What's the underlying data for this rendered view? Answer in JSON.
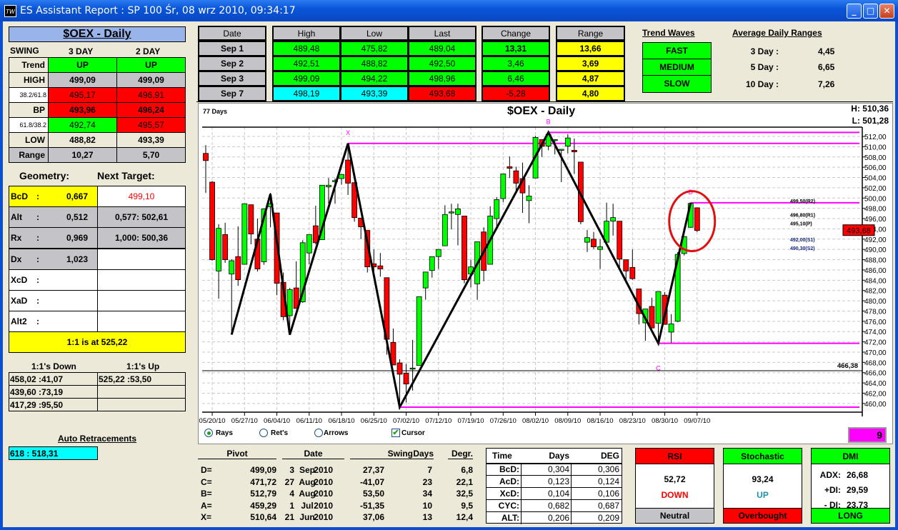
{
  "window": {
    "title": "ES Assistant Report : SP 100  Śr, 08 wrz 2010, 09:34:17",
    "app_icon": "TW",
    "minimize": "_",
    "maximize": "□",
    "close": "✕"
  },
  "swing": {
    "title": "$OEX - Daily",
    "col0": "SWING",
    "col1": "3 DAY",
    "col2": "2 DAY",
    "rows": [
      {
        "label": "Trend",
        "v3": "UP",
        "v2": "UP"
      },
      {
        "label": "HIGH",
        "v3": "499,09",
        "v2": "499,09"
      },
      {
        "label": "38.2/61.8",
        "v3": "495,17",
        "v2": "496,91"
      },
      {
        "label": "BP",
        "v3": "493,96",
        "v2": "496,24"
      },
      {
        "label": "61.8/38.2",
        "v3": "492,74",
        "v2": "495,57"
      },
      {
        "label": "LOW",
        "v3": "488,82",
        "v2": "493,39"
      },
      {
        "label": "Range",
        "v3": "10,27",
        "v2": "5,70"
      }
    ]
  },
  "geometry": {
    "title": "Geometry:",
    "next_title": "Next Target:",
    "rows": [
      {
        "label": "BcD",
        "sep": ":",
        "value": "0,667",
        "target": "499,10"
      },
      {
        "label": "Alt",
        "sep": ":",
        "value": "0,512",
        "target": "0,577: 502,61"
      },
      {
        "label": "Rx",
        "sep": ":",
        "value": "0,969",
        "target": "1,000: 500,36"
      },
      {
        "label": "Dx",
        "sep": ":",
        "value": "1,023",
        "target": ""
      },
      {
        "label": "XcD",
        "sep": ":",
        "value": "",
        "target": ""
      },
      {
        "label": "XaD",
        "sep": ":",
        "value": "",
        "target": ""
      },
      {
        "label": "Alt2",
        "sep": ":",
        "value": "",
        "target": ""
      }
    ],
    "one_to_one": "1:1 is at 525,22"
  },
  "ones": {
    "down_title": "1:1's Down",
    "up_title": "1:1's Up",
    "down": [
      "458,02 :41,07",
      "439,60 :73,19",
      "417,29 :95,50"
    ],
    "up": [
      "525,22 :53,50",
      "",
      ""
    ]
  },
  "auto_retracements": {
    "title": "Auto Retracements",
    "value": "618 : 518,31"
  },
  "daily": {
    "headers": {
      "date": "Date",
      "high": "High",
      "low": "Low",
      "last": "Last",
      "change": "Change",
      "range": "Range"
    },
    "rows": [
      {
        "date": "Sep  1",
        "high": "489,48",
        "low": "475,82",
        "last": "489,04",
        "change": "13,31",
        "range": "13,66"
      },
      {
        "date": "Sep  2",
        "high": "492,51",
        "low": "488,82",
        "last": "492,50",
        "change": "3,46",
        "range": "3,69"
      },
      {
        "date": "Sep  3",
        "high": "499,09",
        "low": "494,22",
        "last": "498,96",
        "change": "6,46",
        "range": "4,87"
      },
      {
        "date": "Sep  7",
        "high": "498,19",
        "low": "493,39",
        "last": "493,68",
        "change": "-5,28",
        "range": "4,80"
      }
    ]
  },
  "trend_waves": {
    "title": "Trend Waves",
    "items": [
      "FAST",
      "MEDIUM",
      "SLOW"
    ]
  },
  "adr": {
    "title": "Average Daily Ranges",
    "rows": [
      {
        "label": "3 Day :",
        "value": "4,45"
      },
      {
        "label": "5 Day :",
        "value": "6,65"
      },
      {
        "label": "10 Day :",
        "value": "7,26"
      }
    ]
  },
  "chart_header": {
    "days": "77 Days",
    "title": "$OEX - Daily",
    "high": "H:  510,36",
    "low": "L:  501,28"
  },
  "controls": {
    "rays": "Rays",
    "rets": "Ret's",
    "arrows": "Arrows",
    "cursor": "Cursor",
    "selected": "Rays",
    "cursor_checked": true,
    "counter": "9"
  },
  "chart_data": {
    "type": "candlestick",
    "title": "$OEX - Daily",
    "ylim": [
      459,
      514
    ],
    "y_ticks": [
      "460,00",
      "462,00",
      "464,00",
      "466,00",
      "468,00",
      "470,00",
      "472,00",
      "474,00",
      "476,00",
      "478,00",
      "480,00",
      "482,00",
      "484,00",
      "486,00",
      "488,00",
      "490,00",
      "492,00",
      "494,00",
      "496,00",
      "498,00",
      "500,00",
      "502,00",
      "504,00",
      "506,00",
      "508,00",
      "510,00",
      "512,00"
    ],
    "x_ticks": [
      {
        "label": "05/20/10",
        "index": 1
      },
      {
        "label": "05/27/10",
        "index": 6
      },
      {
        "label": "06/04/10",
        "index": 11
      },
      {
        "label": "06/11/10",
        "index": 16
      },
      {
        "label": "06/18/10",
        "index": 21
      },
      {
        "label": "06/25/10",
        "index": 26
      },
      {
        "label": "07/02/10",
        "index": 31
      },
      {
        "label": "07/12/10",
        "index": 36
      },
      {
        "label": "07/19/10",
        "index": 41
      },
      {
        "label": "07/26/10",
        "index": 46
      },
      {
        "label": "08/02/10",
        "index": 51
      },
      {
        "label": "08/09/10",
        "index": 56
      },
      {
        "label": "08/16/10",
        "index": 61
      },
      {
        "label": "08/23/10",
        "index": 66
      },
      {
        "label": "08/30/10",
        "index": 71
      },
      {
        "label": "09/07/10",
        "index": 76
      }
    ],
    "candles_ohlc": [
      [
        508.7,
        510.3,
        501,
        507.3
      ],
      [
        503.1,
        503.3,
        487.8,
        488.0
      ],
      [
        485.8,
        494.9,
        480.4,
        494.1
      ],
      [
        492.9,
        495.2,
        487.4,
        488.0
      ],
      [
        485.2,
        488.1,
        473.4,
        487.8
      ],
      [
        488.6,
        494.5,
        482.9,
        484.1
      ],
      [
        487.1,
        498.9,
        487.1,
        498.9
      ],
      [
        498.7,
        498.7,
        491.0,
        493.0
      ],
      [
        492.0,
        496.0,
        485.7,
        486.2
      ],
      [
        487.6,
        497.9,
        487.0,
        497.9
      ],
      [
        498.3,
        501.0,
        494.3,
        498.9
      ],
      [
        497.1,
        497.1,
        481.1,
        483.4
      ],
      [
        483.6,
        485.5,
        476.2,
        476.9
      ],
      [
        477.1,
        482.5,
        473.4,
        482.2
      ],
      [
        482.5,
        487.7,
        478.5,
        478.5
      ],
      [
        479.8,
        491.8,
        479.6,
        491.3
      ],
      [
        489.3,
        492.9,
        487.1,
        492.9
      ],
      [
        494.6,
        498.5,
        491.0,
        491.3
      ],
      [
        491.9,
        502.5,
        491.9,
        502.5
      ],
      [
        502.2,
        503.9,
        498.9,
        502.5
      ],
      [
        503.3,
        503.8,
        498.9,
        503.4
      ],
      [
        503.8,
        504.6,
        502.6,
        504.6
      ],
      [
        507.4,
        510.6,
        500.6,
        502.9
      ],
      [
        503.0,
        503.0,
        495.4,
        496.2
      ],
      [
        496.1,
        496.1,
        492.0,
        494.4
      ],
      [
        493.7,
        493.7,
        485.5,
        486.6
      ],
      [
        487.2,
        490.0,
        485.2,
        486.6
      ],
      [
        486.8,
        489.3,
        484.7,
        486.2
      ],
      [
        484.5,
        484.5,
        469.5,
        472.5
      ],
      [
        471.9,
        474.6,
        467.5,
        467.5
      ],
      [
        467.9,
        468.6,
        459.3,
        465.7
      ],
      [
        465.9,
        467.7,
        460.2,
        463.8
      ],
      [
        466.9,
        472.4,
        462.5,
        466.9
      ],
      [
        467.4,
        480.8,
        467.4,
        480.8
      ],
      [
        482.5,
        485.6,
        480.2,
        485.6
      ],
      [
        485.9,
        488.6,
        484.5,
        488.6
      ],
      [
        488.6,
        490.0,
        486.2,
        490.0
      ],
      [
        490.7,
        498.6,
        490.7,
        496.8
      ],
      [
        497.3,
        498.9,
        493.9,
        497.3
      ],
      [
        496.8,
        498.9,
        490.8,
        497.9
      ],
      [
        496.5,
        496.5,
        483.4,
        484.1
      ],
      [
        485.2,
        488.0,
        482.6,
        486.6
      ],
      [
        483.3,
        491.5,
        480.2,
        491.5
      ],
      [
        493.4,
        494.3,
        483.8,
        485.9
      ],
      [
        487.1,
        498.4,
        487.1,
        496.5
      ],
      [
        496.0,
        500.2,
        494.5,
        499.7
      ],
      [
        499.9,
        504.7,
        499.2,
        504.7
      ],
      [
        506.1,
        508.1,
        503.9,
        505.8
      ],
      [
        505.3,
        506.1,
        501.5,
        502.9
      ],
      [
        503.8,
        506.9,
        497.1,
        501.0
      ],
      [
        499.5,
        502.5,
        495.1,
        500.4
      ],
      [
        503.9,
        512.1,
        503.9,
        511.8
      ],
      [
        511.4,
        511.4,
        508.0,
        510.1
      ],
      [
        510.1,
        512.8,
        509.3,
        512.4
      ],
      [
        511.4,
        511.4,
        508.5,
        511.4
      ],
      [
        509.5,
        509.5,
        503.1,
        509.5
      ],
      [
        510.1,
        512.4,
        508.7,
        511.7
      ],
      [
        509.3,
        511.6,
        504.7,
        509.0
      ],
      [
        507.0,
        507.0,
        494.9,
        495.4
      ],
      [
        491.4,
        493.8,
        489.5,
        492.3
      ],
      [
        492.0,
        493.4,
        490.1,
        490.5
      ],
      [
        490.0,
        492.0,
        486.2,
        490.5
      ],
      [
        491.4,
        499.1,
        491.4,
        495.5
      ],
      [
        495.5,
        498.9,
        492.7,
        496.2
      ],
      [
        495.5,
        495.5,
        486.2,
        488.1
      ],
      [
        488.0,
        488.0,
        483.4,
        485.8
      ],
      [
        486.5,
        490.0,
        484.1,
        484.3
      ],
      [
        482.3,
        482.3,
        475.4,
        477.5
      ],
      [
        475.7,
        478.4,
        472.2,
        478.4
      ],
      [
        478.9,
        480.6,
        474.7,
        474.7
      ],
      [
        475.6,
        481.8,
        471.7,
        481.8
      ],
      [
        481.1,
        481.7,
        475.4,
        475.4
      ],
      [
        473.9,
        477.4,
        471.8,
        475.5
      ],
      [
        476.0,
        489.48,
        475.82,
        489.04
      ],
      [
        489.2,
        492.51,
        488.82,
        492.5
      ],
      [
        494.3,
        499.09,
        494.22,
        498.96
      ],
      [
        498.1,
        498.19,
        493.39,
        493.68
      ]
    ],
    "zigzag": [
      {
        "index": 4,
        "price": 473.4
      },
      {
        "index": 10,
        "price": 500.8
      },
      {
        "index": 13,
        "price": 473.4
      },
      {
        "index": 22,
        "price": 510.64,
        "label": "X"
      },
      {
        "index": 30,
        "price": 459.29,
        "label": ""
      },
      {
        "index": 53,
        "price": 512.79,
        "label": "B"
      },
      {
        "index": 70,
        "price": 471.72,
        "label": "C"
      },
      {
        "index": 75,
        "price": 499.09,
        "label": "D"
      }
    ],
    "levels": [
      {
        "from_index": 22,
        "price": 510.64
      },
      {
        "from_index": 53,
        "price": 512.79
      },
      {
        "from_index": 30,
        "price": 459.29
      },
      {
        "from_index": 70,
        "price": 471.72
      },
      {
        "from_index": 75,
        "price": 499.09
      }
    ],
    "reference_line": {
      "price": 466.38,
      "label": "466,38"
    },
    "pivots": [
      {
        "price": 499.5,
        "label": "499,50(R2)"
      },
      {
        "price": 496.8,
        "label": "496,80(R1)"
      },
      {
        "price": 495.1,
        "label": "495,10(P)"
      },
      {
        "price": 492.0,
        "label": "492,00(S1)"
      },
      {
        "price": 490.3,
        "label": "490,30(S2)"
      }
    ],
    "last_price": {
      "price": 493.68,
      "label": "493,68"
    },
    "colors": {
      "up": "#00ff00",
      "down": "#ff0000",
      "levels": "#ff00ff",
      "zigzag": "#000000",
      "highlight": "#e01010"
    }
  },
  "pivot_table": {
    "headers": [
      "Pivot",
      "Date",
      "Swing",
      "Days",
      "Degr."
    ],
    "rows": [
      {
        "name": "D=",
        "pivot": "499,09",
        "day": "3",
        "month": "Sep",
        "year": "2010",
        "swing": "27,37",
        "days": "7",
        "degr": "6,8"
      },
      {
        "name": "C=",
        "pivot": "471,72",
        "day": "27",
        "month": "Aug",
        "year": "2010",
        "swing": "-41,07",
        "days": "23",
        "degr": "22,1"
      },
      {
        "name": "B=",
        "pivot": "512,79",
        "day": "4",
        "month": "Aug",
        "year": "2010",
        "swing": "53,50",
        "days": "34",
        "degr": "32,5"
      },
      {
        "name": "A=",
        "pivot": "459,29",
        "day": "1",
        "month": "Jul",
        "year": "2010",
        "swing": "-51,35",
        "days": "10",
        "degr": "9,5"
      },
      {
        "name": "X=",
        "pivot": "510,64",
        "day": "21",
        "month": "Jun",
        "year": "2010",
        "swing": "37,06",
        "days": "13",
        "degr": "12,4"
      }
    ]
  },
  "time_table": {
    "headers": [
      "Time",
      "Days",
      "DEG"
    ],
    "rows": [
      {
        "label": "BcD:",
        "days": "0,304",
        "deg": "0,306"
      },
      {
        "label": "AcD:",
        "days": "0,123",
        "deg": "0,124"
      },
      {
        "label": "XcD:",
        "days": "0,104",
        "deg": "0,106"
      },
      {
        "label": "CYC:",
        "days": "0,682",
        "deg": "0,687"
      },
      {
        "label": "ALT:",
        "days": "0,206",
        "deg": "0,209"
      }
    ]
  },
  "rsi": {
    "title": "RSI",
    "value": "52,72",
    "direction": "DOWN",
    "status": "Neutral"
  },
  "stochastic": {
    "title": "Stochastic",
    "value": "93,24",
    "direction": "UP",
    "status": "Overbought"
  },
  "dmi": {
    "title": "DMI",
    "adx_label": "ADX:",
    "adx": "26,68",
    "pdi_label": "+DI:",
    "pdi": "29,59",
    "mdi_label": "- DI:",
    "mdi": "23,73",
    "status": "LONG"
  }
}
